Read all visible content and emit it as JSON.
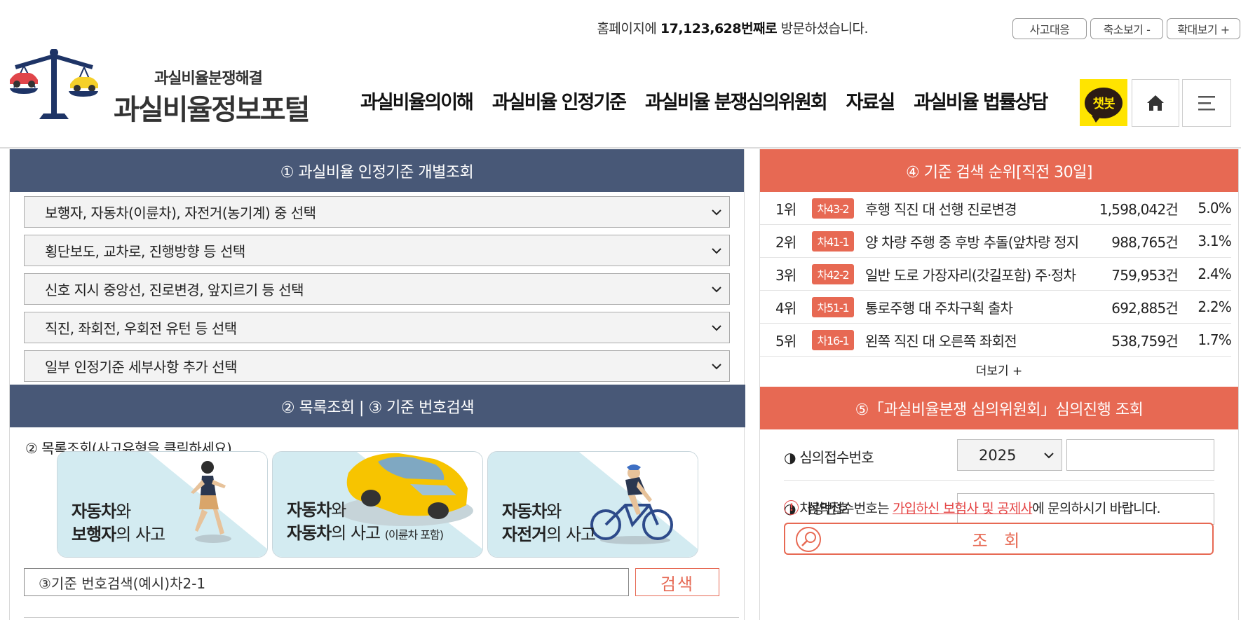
{
  "topbar": {
    "visit_prefix": "홈페이지에",
    "visit_count": "17,123,628번째로",
    "visit_suffix": "방문하셨습니다.",
    "btn_accident": "사고대응",
    "btn_zoom_out": "축소보기 -",
    "btn_zoom_in": "확대보기 +"
  },
  "header": {
    "logo_sub": "과실비율분쟁해결",
    "logo_title": "과실비율정보포털",
    "nav": [
      "과실비율의이해",
      "과실비율 인정기준",
      "과실비율 분쟁심의위원회",
      "자료실",
      "과실비율 법률상담"
    ],
    "chatbot_label": "챗봇",
    "home_icon": "home-icon",
    "menu_icon": "hamburger-icon"
  },
  "section1": {
    "title": "① 과실비율 인정기준 개별조회",
    "selects": [
      "보행자, 자동차(이륜차), 자전거(농기계) 중 선택",
      "횡단보도, 교차로, 진행방향 등 선택",
      "신호 지시 중앙선, 진로변경, 앞지르기 등 선택",
      "직진, 좌회전, 우회전 유턴 등 선택",
      "일부 인정기준 세부사항 추가 선택"
    ]
  },
  "section2": {
    "title": "② 목록조회 | ③ 기준 번호검색",
    "caption": "② 목록조회(사고유형을 클릭하세요)",
    "cards": [
      {
        "a": "자동차",
        "b": "와",
        "c": "보행자",
        "d": "의 사고",
        "e": ""
      },
      {
        "a": "자동차",
        "b": "와",
        "c": "자동차",
        "d": "의 사고",
        "e": "(이륜차 포함)"
      },
      {
        "a": "자동차",
        "b": "와",
        "c": "자전거",
        "d": "의 사고",
        "e": ""
      }
    ],
    "search_value": "③기준 번호검색(예시)차2-1",
    "search_button": "검색"
  },
  "section4": {
    "title": "④ 기준 검색 순위[직전 30일]",
    "ranks": [
      {
        "no": "1위",
        "tag": "차43-2",
        "title": "후행 직진 대 선행 진로변경",
        "count": "1,598,042건",
        "pct": "5.0%"
      },
      {
        "no": "2위",
        "tag": "차41-1",
        "title": "양 차량 주행 중 후방 추돌(앞차량 정지",
        "count": "988,765건",
        "pct": "3.1%"
      },
      {
        "no": "3위",
        "tag": "차42-2",
        "title": "일반 도로 가장자리(갓길포함) 주·정차",
        "count": "759,953건",
        "pct": "2.4%"
      },
      {
        "no": "4위",
        "tag": "차51-1",
        "title": "통로주행 대 주차구획 출차",
        "count": "692,885건",
        "pct": "2.2%"
      },
      {
        "no": "5위",
        "tag": "차16-1",
        "title": "왼쪽 직진 대 오른쪽 좌회전",
        "count": "538,759건",
        "pct": "1.7%"
      }
    ],
    "more": "더보기 +"
  },
  "section5": {
    "title": "⑤「과실비율분쟁 심의위원회」심의진행 조회",
    "label_receipt": "◑ 심의접수번호",
    "year": "2025",
    "label_car": "◑ 차량번호",
    "notice_pre": "심의접수번호는",
    "notice_link": "가입하신 보험사 및 공제사",
    "notice_post": "에 문의하시기 바랍니다.",
    "lookup_button": "조 회"
  },
  "colors": {
    "navy": "#485877",
    "orange": "#e76953",
    "chatbot_yellow": "#ffe400"
  }
}
